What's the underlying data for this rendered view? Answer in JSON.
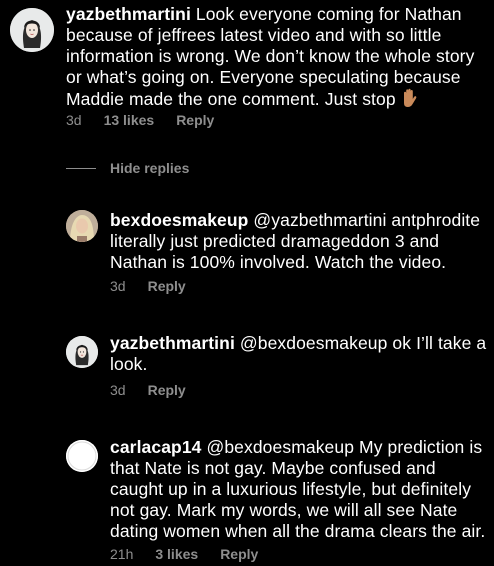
{
  "comments": [
    {
      "username": "yazbethmartini",
      "text": "Look everyone coming for Nathan because of jeffrees latest video and with so little information is wrong. We don’t know the whole story or what’s going on. Everyone speculating because Maddie made the one comment. Just stop",
      "emoji": "raised-hand",
      "time": "3d",
      "likes": "13 likes",
      "reply": "Reply"
    },
    {
      "username": "bexdoesmakeup",
      "text": "@yazbethmartini antphrodite literally just predicted dramageddon 3 and Nathan is 100% involved. Watch the video.",
      "time": "3d",
      "reply": "Reply"
    },
    {
      "username": "yazbethmartini",
      "text": "@bexdoesmakeup ok I’ll take a look.",
      "time": "3d",
      "reply": "Reply"
    },
    {
      "username": "carlacap14",
      "text": "@bexdoesmakeup My prediction is that Nate is not gay. Maybe confused and caught up in a luxurious lifestyle, but definitely not gay. Mark my words, we will all see Nate dating women when all the drama clears the air.",
      "time": "21h",
      "likes": "3 likes",
      "reply": "Reply"
    }
  ],
  "hide_replies_label": "Hide replies",
  "colors": {
    "background": "#000000",
    "text": "#ffffff",
    "muted": "#8e8e8e",
    "skin": "#c98a5a"
  }
}
